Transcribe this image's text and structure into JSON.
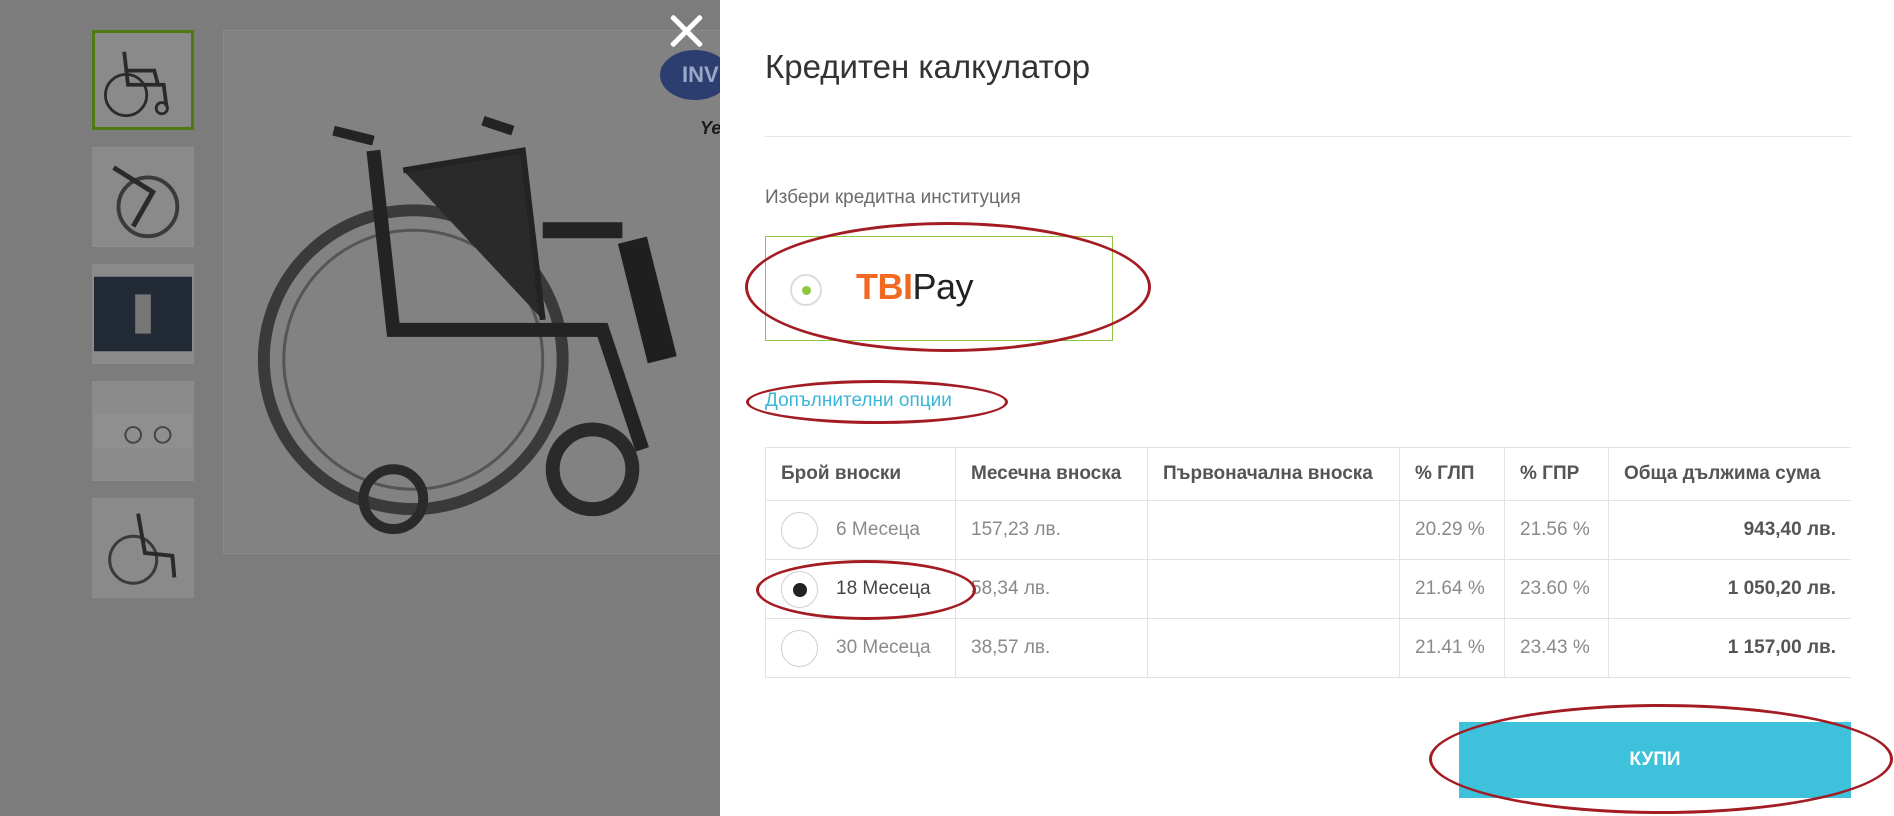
{
  "calculator": {
    "title": "Кредитен калкулатор",
    "institution_label": "Избери кредитна институция",
    "provider": {
      "name_part1": "TBI",
      "name_part2": "Pay",
      "selected": true
    },
    "extra_options_link": "Допълнителни опции",
    "table": {
      "headers": [
        "Брой вноски",
        "Месечна вноска",
        "Първоначална вноска",
        "% ГЛП",
        "% ГПР",
        "Обща дължима сума"
      ],
      "rows": [
        {
          "term": "6 Месеца",
          "monthly": "157,23 лв.",
          "initial": "",
          "glp": "20.29 %",
          "gpr": "21.56 %",
          "total": "943,40 лв.",
          "selected": false
        },
        {
          "term": "18 Месеца",
          "monthly": "58,34 лв.",
          "initial": "",
          "glp": "21.64 %",
          "gpr": "23.60 %",
          "total": "1 050,20 лв.",
          "selected": true
        },
        {
          "term": "30 Месеца",
          "monthly": "38,57 лв.",
          "initial": "",
          "glp": "21.41 %",
          "gpr": "23.43 %",
          "total": "1 157,00 лв.",
          "selected": false
        }
      ]
    },
    "buy_button": "КУПИ"
  },
  "background": {
    "brand_badge": "INV",
    "brand_tag": "Ye"
  },
  "colors": {
    "accent_green": "#8dc63f",
    "link_blue": "#39b6d8",
    "button_blue": "#3ec1db",
    "tbi_orange": "#f26a21",
    "annotation_red": "#a41c23"
  }
}
